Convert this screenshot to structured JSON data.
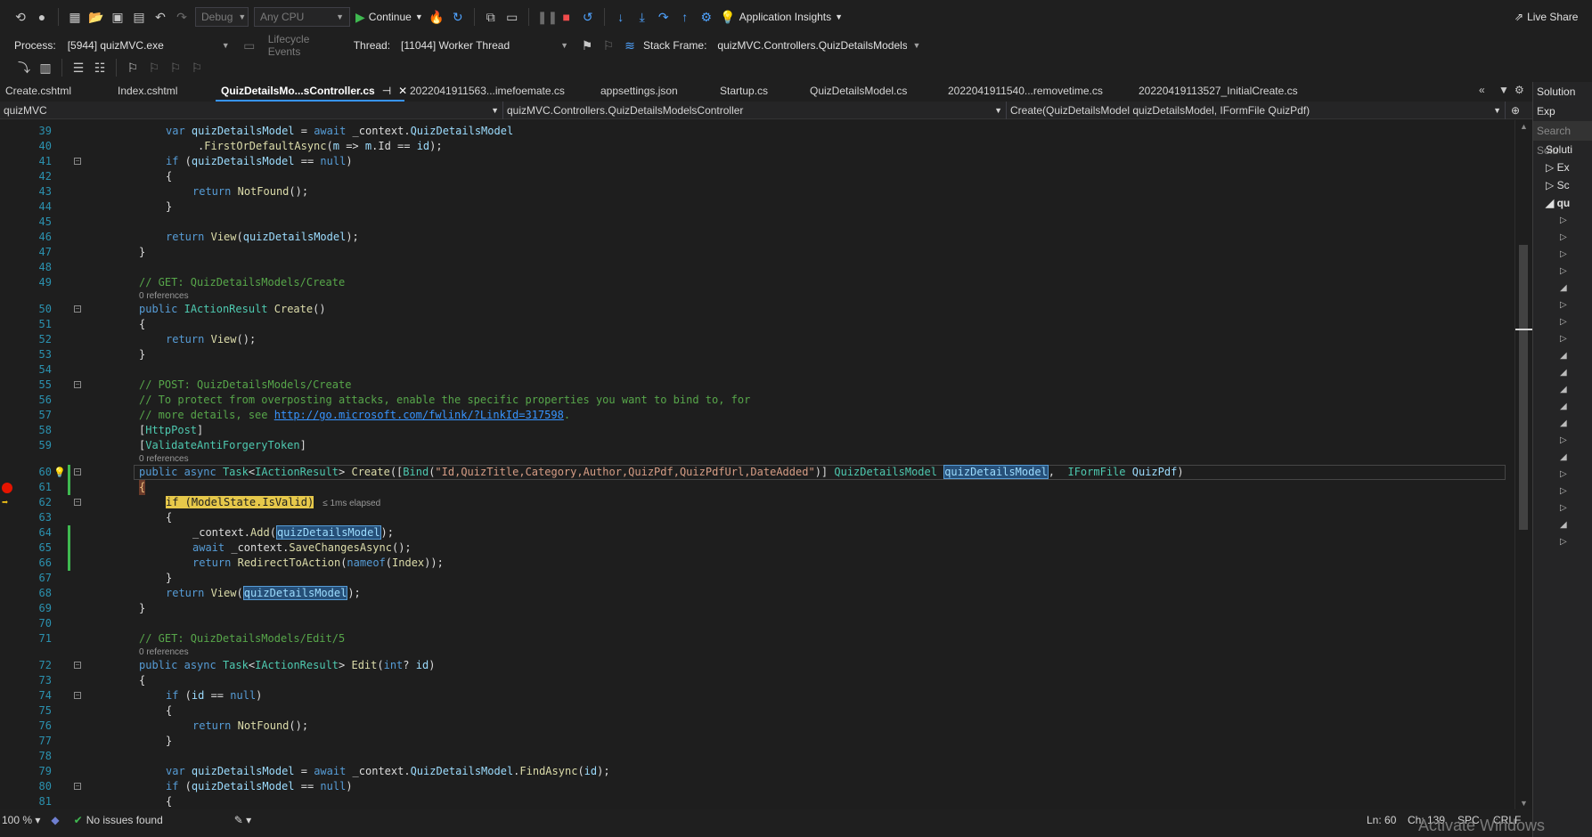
{
  "toolbar": {
    "config": "Debug",
    "platform": "Any CPU",
    "continue_label": "Continue",
    "app_insights": "Application Insights",
    "live_share": "Live Share"
  },
  "debugbar": {
    "process_label": "Process:",
    "process_value": "[5944] quizMVC.exe",
    "lifecycle": "Lifecycle Events",
    "thread_label": "Thread:",
    "thread_value": "[11044] Worker Thread",
    "stack_label": "Stack Frame:",
    "stack_value": "quizMVC.Controllers.QuizDetailsModelsC"
  },
  "tabs": [
    {
      "label": "Create.cshtml"
    },
    {
      "label": "Index.cshtml"
    },
    {
      "label": "QuizDetailsMo...sController.cs",
      "active": true
    },
    {
      "label": "2022041911563...imefoemate.cs"
    },
    {
      "label": "appsettings.json"
    },
    {
      "label": "Startup.cs"
    },
    {
      "label": "QuizDetailsModel.cs"
    },
    {
      "label": "2022041911540...removetime.cs"
    },
    {
      "label": "20220419113527_InitialCreate.cs"
    }
  ],
  "navbar": {
    "project": "quizMVC",
    "class": "quizMVC.Controllers.QuizDetailsModelsController",
    "member": "Create(QuizDetailsModel quizDetailsModel, IFormFile QuizPdf)"
  },
  "solution_explorer": {
    "title": "Solution Exp",
    "search": "Search Solu",
    "root": "Soluti",
    "items": [
      "Ex",
      "Sc",
      "qu"
    ]
  },
  "code": {
    "references_label": "0 references",
    "elapsed": "≤ 1ms elapsed",
    "line_numbers": [
      "39",
      "40",
      "41",
      "42",
      "43",
      "44",
      "45",
      "46",
      "47",
      "48",
      "49",
      "50",
      "51",
      "52",
      "53",
      "54",
      "55",
      "56",
      "57",
      "58",
      "59",
      "60",
      "61",
      "62",
      "63",
      "64",
      "65",
      "66",
      "67",
      "68",
      "69",
      "70",
      "71",
      "72",
      "73",
      "74",
      "75",
      "76",
      "77",
      "78",
      "79",
      "80",
      "81"
    ]
  },
  "status": {
    "zoom": "100 %",
    "issues": "No issues found",
    "ln": "Ln: 60",
    "ch": "Ch: 139",
    "spc": "SPC",
    "crlf": "CRLF"
  },
  "watermark": "Activate Windows"
}
